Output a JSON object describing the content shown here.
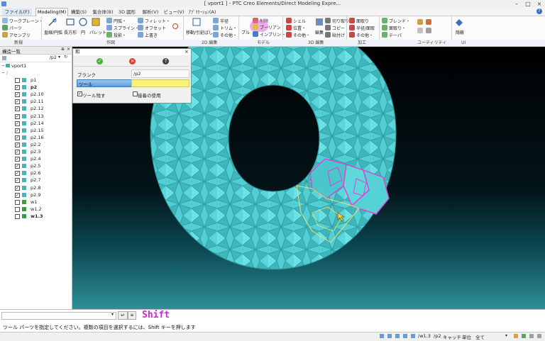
{
  "window": {
    "title": "[ vport1 ] - PTC Creo Elements/Direct Modeling Expre..."
  },
  "tabs": [
    {
      "label": "ファイル(F)"
    },
    {
      "label": "Modeling(M)"
    },
    {
      "label": "構築(S)"
    },
    {
      "label": "集合体(B)"
    },
    {
      "label": "3D 図形"
    },
    {
      "label": "解析(V)"
    },
    {
      "label": "ビュー(V)"
    },
    {
      "label": "ｱﾌﾟﾘｹｰｼｮﾝ(A)"
    }
  ],
  "ribbon": {
    "new_group": {
      "items": [
        "ワークプレーン・",
        "パーツ",
        "アセンブリ"
      ],
      "label": "新規"
    },
    "draw_group": {
      "big": [
        "直線/円弧",
        "長方形",
        "円",
        "パレット"
      ],
      "small": [
        "円弧・",
        "スプライン・",
        "投影・",
        "フィレット・",
        "オフセット",
        "上書き"
      ],
      "label": "作図"
    },
    "edit2d_group": {
      "items": [
        "移動/引延ばし",
        "半径",
        "トリム・",
        "その他・"
      ],
      "label": "2D 編集"
    },
    "model_group": {
      "items": [
        "削除",
        "ブーリアン",
        "インプリント・",
        "プル"
      ],
      "label": "モデル"
    },
    "edit3d_group": {
      "items": [
        "シェル",
        "位置・",
        "その他・",
        "編集",
        "切り取り",
        "コピー",
        "貼付け"
      ],
      "label": "3D 編集"
    },
    "machining_group": {
      "items": [
        "面取り",
        "半径/面取",
        "その他・"
      ],
      "label": "加工"
    },
    "utility_group": {
      "items": [
        "ブレンド・",
        "面取り・",
        "テーパ",
        "隠蔽"
      ],
      "label": "ユーティリティ"
    },
    "ui_group": {
      "label": "UI"
    }
  },
  "structure_panel": {
    "title": "構造一覧",
    "filter": "/p2",
    "root": "vport1",
    "items": [
      {
        "label": "p1",
        "checked": false,
        "bold": false
      },
      {
        "label": "p2",
        "checked": true,
        "bold": true
      },
      {
        "label": "p2.10",
        "checked": true,
        "bold": false
      },
      {
        "label": "p2.11",
        "checked": true,
        "bold": false
      },
      {
        "label": "p2.12",
        "checked": true,
        "bold": false
      },
      {
        "label": "p2.13",
        "checked": true,
        "bold": false
      },
      {
        "label": "p2.14",
        "checked": true,
        "bold": false
      },
      {
        "label": "p2.15",
        "checked": true,
        "bold": false
      },
      {
        "label": "p2.16",
        "checked": true,
        "bold": false
      },
      {
        "label": "p2.2",
        "checked": true,
        "bold": false
      },
      {
        "label": "p2.3",
        "checked": true,
        "bold": false
      },
      {
        "label": "p2.4",
        "checked": true,
        "bold": false
      },
      {
        "label": "p2.5",
        "checked": true,
        "bold": false
      },
      {
        "label": "p2.6",
        "checked": true,
        "bold": false
      },
      {
        "label": "p2.7",
        "checked": true,
        "bold": false
      },
      {
        "label": "p2.8",
        "checked": true,
        "bold": false
      },
      {
        "label": "p2.9",
        "checked": true,
        "bold": false
      },
      {
        "label": "w1",
        "checked": false,
        "bold": false
      },
      {
        "label": "w1.2",
        "checked": false,
        "bold": false
      },
      {
        "label": "w1.3",
        "checked": false,
        "bold": true
      }
    ]
  },
  "dialog": {
    "title": "和",
    "blank_label": "ブランク",
    "blank_value": "/p2",
    "tool_label": "ツール",
    "keep_tool_label": "ツール残す",
    "keep_tool_checked": true,
    "use_contact_label": "接着の使用",
    "use_contact_checked": false
  },
  "viewport": {
    "name": "vport1",
    "model_color": "#53d3d6",
    "highlight_color": "#e33dd8",
    "selected_color": "#e8e06a"
  },
  "command": {
    "input_value": "",
    "key_hint": "Shift",
    "enter_symbol": "↵"
  },
  "prompt": "ツール パーツを指定してください。複数の項目を選択するには、Shift キーを押します",
  "statusbar": {
    "part": "/w1.3",
    "workplane": "/p2",
    "catch_label": "キャッチ",
    "unit_label": "単位",
    "mode": "全て"
  }
}
